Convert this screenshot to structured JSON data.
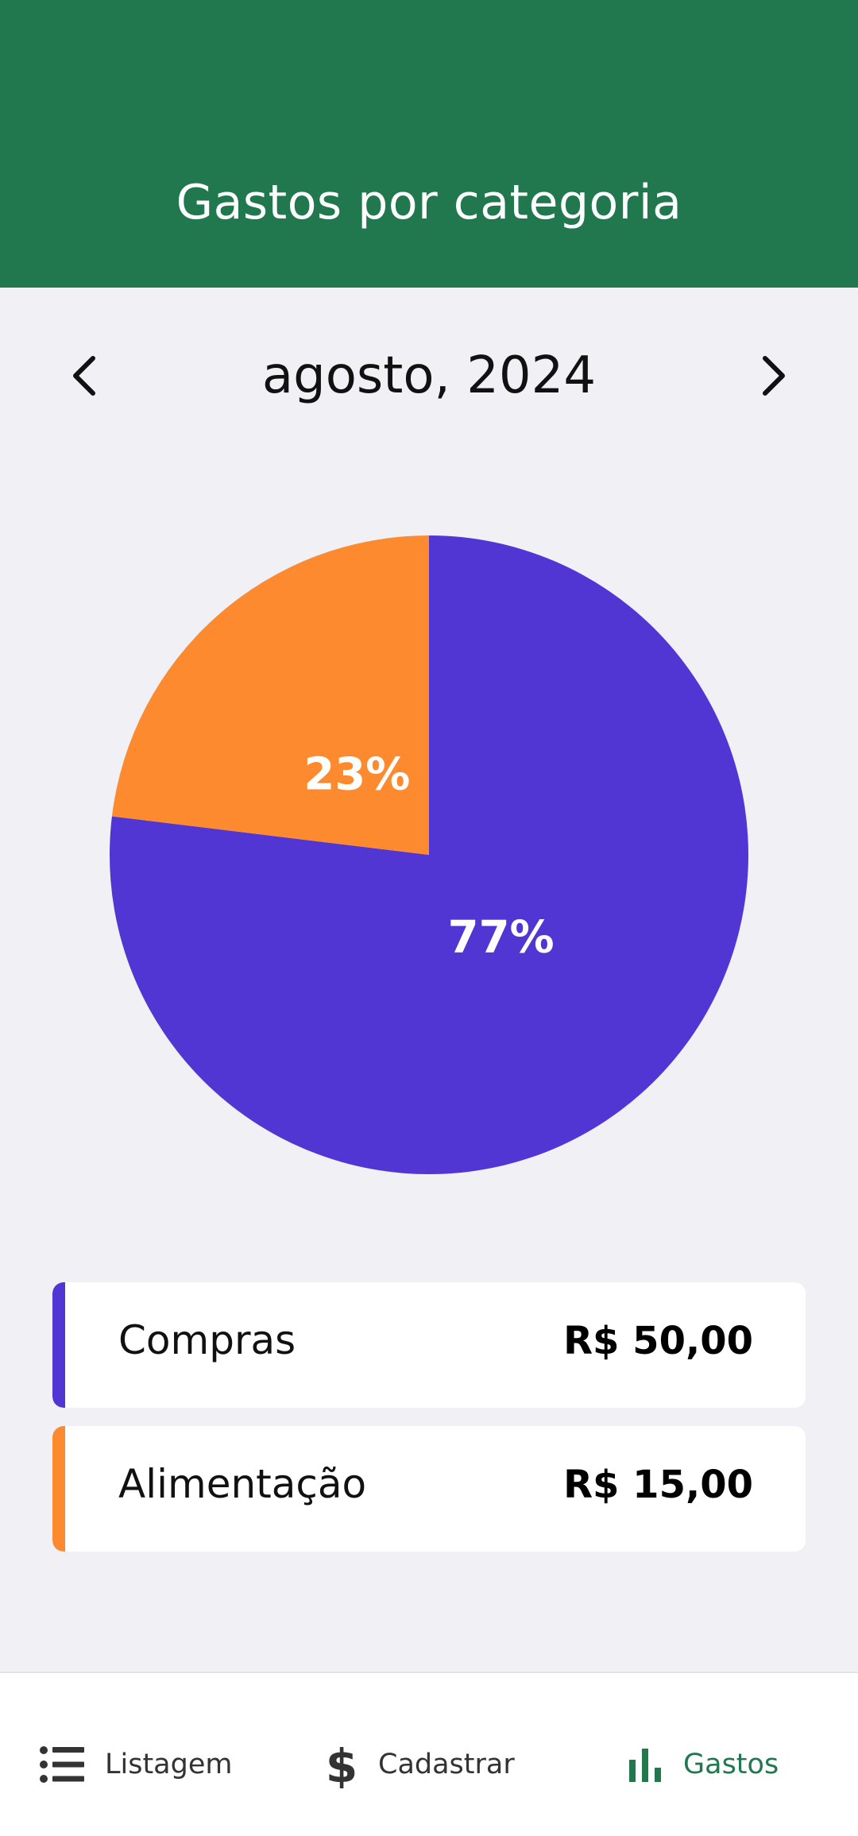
{
  "header": {
    "title": "Gastos por categoria"
  },
  "period": {
    "label": "agosto, 2024",
    "prev_icon": "chevron-left-icon",
    "next_icon": "chevron-right-icon"
  },
  "chart_data": {
    "type": "pie",
    "title": "",
    "slices": [
      {
        "label": "Compras",
        "value": 50,
        "percent_label": "77%",
        "color": "#5236d4"
      },
      {
        "label": "Alimentação",
        "value": 15,
        "percent_label": "23%",
        "color": "#fd8a2e"
      }
    ]
  },
  "legend": [
    {
      "name": "Compras",
      "value": "R$ 50,00",
      "color": "#5236d4"
    },
    {
      "name": "Alimentação",
      "value": "R$ 15,00",
      "color": "#fd8a2e"
    }
  ],
  "bottom_nav": {
    "items": [
      {
        "label": "Listagem",
        "icon": "list-icon",
        "active": false
      },
      {
        "label": "Cadastrar",
        "icon": "dollar-icon",
        "active": false
      },
      {
        "label": "Gastos",
        "icon": "bar-chart-icon",
        "active": true
      }
    ]
  },
  "colors": {
    "primary": "#21784f",
    "background": "#f0f0f5"
  }
}
